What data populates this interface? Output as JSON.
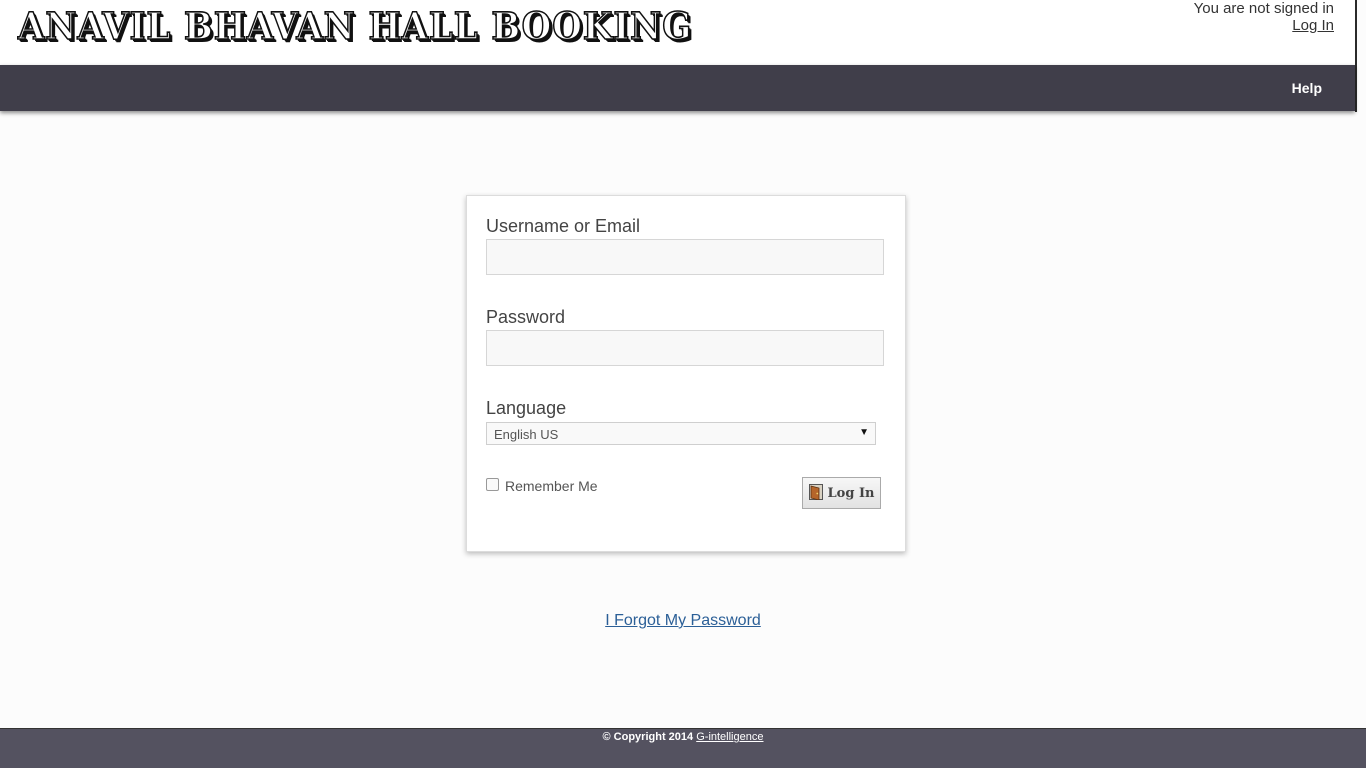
{
  "header": {
    "banner_title": "ANAVIL BHAVAN HALL BOOKING",
    "signin_status": "You are not signed in",
    "login_link": "Log In"
  },
  "nav": {
    "help": "Help"
  },
  "login_form": {
    "username_label": "Username or Email",
    "username_value": "",
    "password_label": "Password",
    "password_value": "",
    "language_label": "Language",
    "language_selected": "English US",
    "remember_label": "Remember Me",
    "remember_checked": false,
    "submit_label": "Log In"
  },
  "forgot_password": "I Forgot My Password",
  "footer": {
    "copyright": "© Copyright 2014",
    "company_link": "G-intelligence"
  },
  "colors": {
    "navbar": "#403e4a",
    "footer": "#545260",
    "link": "#2b5f97"
  }
}
